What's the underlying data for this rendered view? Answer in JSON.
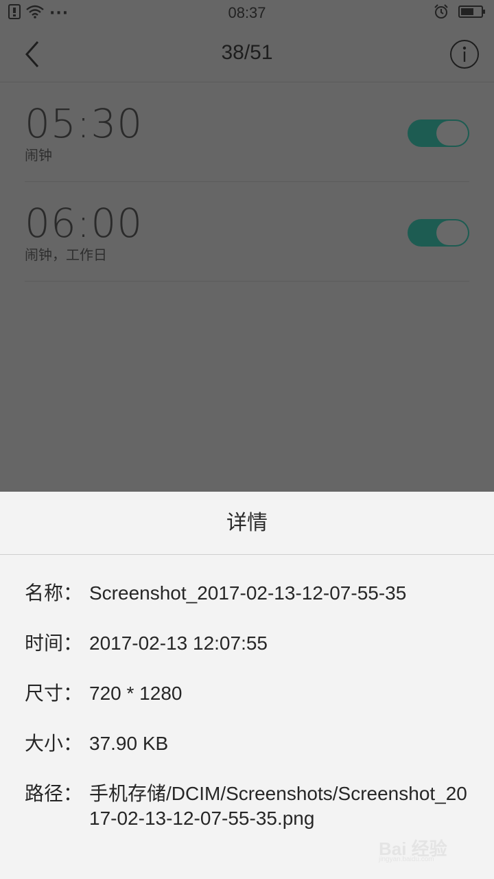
{
  "status_bar": {
    "time": "08:37",
    "more_dots": "···"
  },
  "top_bar": {
    "counter": "38/51"
  },
  "alarms": [
    {
      "time": "05:30",
      "label": "闹钟",
      "enabled": true
    },
    {
      "time": "06:00",
      "label": "闹钟，工作日",
      "enabled": true
    }
  ],
  "details": {
    "title": "详情",
    "rows": [
      {
        "key": "名称：",
        "value": "Screenshot_2017-02-13-12-07-55-35"
      },
      {
        "key": "时间：",
        "value": "2017-02-13 12:07:55"
      },
      {
        "key": "尺寸：",
        "value": "720 * 1280"
      },
      {
        "key": "大小：",
        "value": "37.90 KB"
      },
      {
        "key": "路径：",
        "value": "手机存储/DCIM/Screenshots/Screenshot_2017-02-13-12-07-55-35.png"
      }
    ]
  },
  "watermark": {
    "brand": "Bai 经验",
    "url": "jingyan.baidu.com"
  },
  "colors": {
    "overlay_background": "#666666",
    "toggle_on": "#1d5c52",
    "sheet_background": "#f3f3f3"
  }
}
